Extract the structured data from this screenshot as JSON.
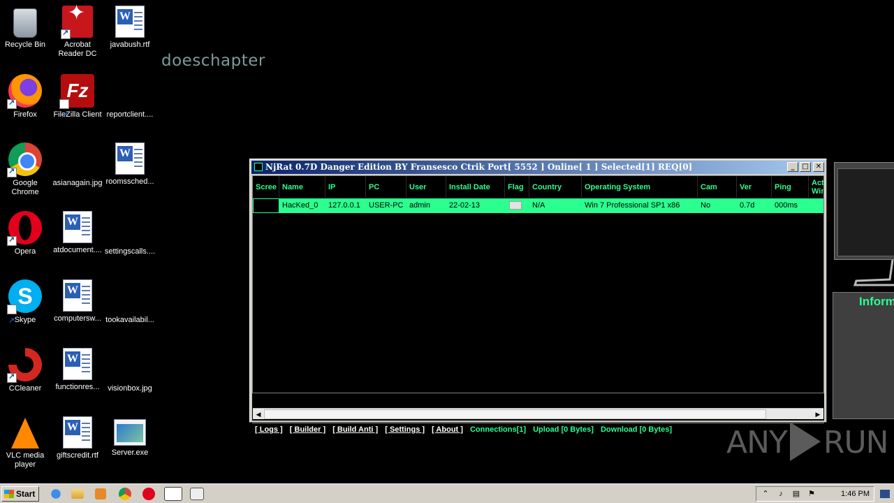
{
  "desktop": {
    "watermark_text": "doeschapter",
    "icons": [
      {
        "label": "Recycle Bin",
        "icon": "recycle-bin-icon"
      },
      {
        "label": "Acrobat Reader DC",
        "icon": "acrobat-icon"
      },
      {
        "label": "javabush.rtf",
        "icon": "word-doc-icon"
      },
      {
        "label": "Firefox",
        "icon": "firefox-icon"
      },
      {
        "label": "FileZilla Client",
        "icon": "filezilla-icon"
      },
      {
        "label": "reportclient....",
        "icon": "blank-file-icon"
      },
      {
        "label": "Google Chrome",
        "icon": "chrome-icon"
      },
      {
        "label": "asianagain.jpg",
        "icon": "image-file-icon"
      },
      {
        "label": "roomssched...",
        "icon": "word-doc-icon"
      },
      {
        "label": "Opera",
        "icon": "opera-icon"
      },
      {
        "label": "atdocument....",
        "icon": "word-doc-icon"
      },
      {
        "label": "settingscalls....",
        "icon": "blank-file-icon"
      },
      {
        "label": "Skype",
        "icon": "skype-icon"
      },
      {
        "label": "computersw...",
        "icon": "word-doc-icon"
      },
      {
        "label": "tookavailabil...",
        "icon": "blank-file-icon"
      },
      {
        "label": "CCleaner",
        "icon": "ccleaner-icon"
      },
      {
        "label": "functionres...",
        "icon": "word-doc-icon"
      },
      {
        "label": "visionbox.jpg",
        "icon": "image-file-icon"
      },
      {
        "label": "VLC media player",
        "icon": "vlc-icon"
      },
      {
        "label": "giftscredit.rtf",
        "icon": "word-doc-icon"
      },
      {
        "label": "Server.exe",
        "icon": "exe-icon"
      }
    ]
  },
  "njrat": {
    "title": "NjRat 0.7D Danger Edition BY Fransesco Ctrik    Port[ 5552 ]    Online[ 1 ]    Selected[1] REQ[0]",
    "columns": [
      "Scree",
      "Name",
      "IP",
      "PC",
      "User",
      "Install Date",
      "Flag",
      "Country",
      "Operating System",
      "Cam",
      "Ver",
      "Ping",
      "Acti Win"
    ],
    "rows": [
      {
        "name": "HacKed_0",
        "ip": "127.0.0.1",
        "pc": "USER-PC",
        "user": "admin",
        "install_date": "22-02-13",
        "country": "N/A",
        "os": "Win 7 Professional SP1 x86",
        "cam": "No",
        "ver": "0.7d",
        "ping": "000ms"
      }
    ],
    "menu": [
      "[ Logs ]",
      "[ Builder ]",
      "[ Build Anti ]",
      "[ Settings ]",
      "[ About ]"
    ],
    "status": {
      "connections": "Connections[1]",
      "upload": "Upload [0 Bytes]",
      "download": "Download [0 Bytes]"
    }
  },
  "right_window": {
    "title_partial": "Inform"
  },
  "watermark_brand": {
    "left": "ANY",
    "right": "RUN"
  },
  "taskbar": {
    "start_label": "Start",
    "clock": "1:46 PM"
  },
  "colors": {
    "accent_green": "#2bff8f",
    "title_blue": "#0a246a"
  }
}
